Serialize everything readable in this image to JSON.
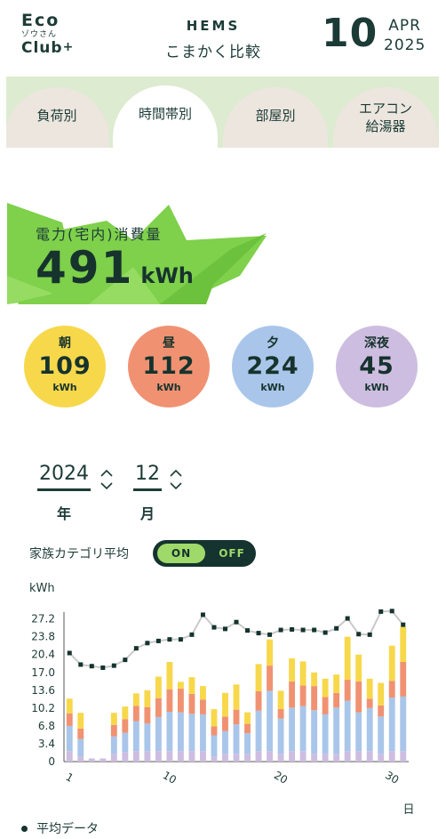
{
  "header": {
    "logo": {
      "line1": "Eco",
      "line2": "ゾウさん",
      "line3": "Club",
      "plus": "+"
    },
    "title1": "HEMS",
    "title2": "こまかく比較",
    "date_day": "10",
    "date_month": "APR",
    "date_year": "2025"
  },
  "tabs": [
    {
      "label": "負荷別",
      "active": false
    },
    {
      "label": "時間帯別",
      "active": true
    },
    {
      "label": "部屋別",
      "active": false
    },
    {
      "label": "エアコン\n給湯器",
      "active": false
    }
  ],
  "energy": {
    "label": "電力(宅内)消費量",
    "value": "491",
    "unit": "kWh"
  },
  "periods": [
    {
      "label": "朝",
      "value": "109",
      "unit": "kWh",
      "color": "#f7d84b"
    },
    {
      "label": "昼",
      "value": "112",
      "unit": "kWh",
      "color": "#f09272"
    },
    {
      "label": "夕",
      "value": "224",
      "unit": "kWh",
      "color": "#a9c6ea"
    },
    {
      "label": "深夜",
      "value": "45",
      "unit": "kWh",
      "color": "#cdbde0"
    }
  ],
  "picker": {
    "year": "2024",
    "year_label": "年",
    "month": "12",
    "month_label": "月"
  },
  "toggle": {
    "label": "家族カテゴリ平均",
    "on": "ON",
    "off": "OFF",
    "state": "on"
  },
  "legend": {
    "label": "平均データ"
  },
  "chart_data": {
    "type": "bar",
    "stacked": true,
    "ylabel": "kWh",
    "xlabel": "日",
    "ylim": [
      0,
      28.5
    ],
    "yticks": [
      0,
      3.4,
      6.8,
      10.2,
      13.6,
      17.0,
      20.4,
      23.8,
      27.2
    ],
    "xticks": [
      1,
      10,
      20,
      30
    ],
    "x": [
      1,
      2,
      3,
      4,
      5,
      6,
      7,
      8,
      9,
      10,
      11,
      12,
      13,
      14,
      15,
      16,
      17,
      18,
      19,
      20,
      21,
      22,
      23,
      24,
      25,
      26,
      27,
      28,
      29,
      30,
      31
    ],
    "series": [
      {
        "color": "#cdbde0",
        "values": [
          2.0,
          1.0,
          0.6,
          0.6,
          1.5,
          1.8,
          2.0,
          2.0,
          2.0,
          2.0,
          2.0,
          2.0,
          2.0,
          1.0,
          1.5,
          1.5,
          1.5,
          2.0,
          2.0,
          1.5,
          2.0,
          2.0,
          1.5,
          1.5,
          1.5,
          2.0,
          2.0,
          2.0,
          1.5,
          2.0,
          2.0
        ]
      },
      {
        "color": "#a9c6ea",
        "values": [
          4.8,
          3.3,
          0.0,
          0.0,
          3.3,
          3.7,
          5.7,
          5.3,
          6.5,
          7.5,
          7.4,
          7.1,
          7.0,
          4.0,
          4.3,
          5.6,
          3.9,
          7.7,
          11.5,
          6.7,
          8.3,
          8.6,
          8.3,
          7.5,
          8.8,
          9.6,
          7.4,
          8.2,
          7.1,
          10.2,
          10.4
        ]
      },
      {
        "color": "#f09272",
        "values": [
          2.4,
          2.0,
          0.0,
          0.0,
          2.2,
          2.6,
          2.9,
          3.1,
          3.6,
          4.3,
          4.5,
          3.8,
          2.8,
          1.7,
          2.8,
          2.8,
          1.8,
          3.7,
          4.8,
          1.8,
          5.0,
          3.9,
          4.6,
          3.3,
          2.8,
          4.0,
          5.9,
          1.8,
          2.1,
          3.2,
          6.6
        ]
      },
      {
        "color": "#f7d84b",
        "values": [
          2.8,
          3.0,
          0.0,
          0.0,
          2.3,
          2.4,
          2.4,
          3.2,
          4.1,
          5.2,
          1.3,
          3.2,
          2.6,
          3.3,
          4.5,
          4.8,
          2.2,
          5.2,
          5.0,
          3.5,
          4.4,
          4.6,
          2.6,
          3.5,
          3.5,
          8.2,
          5.1,
          3.8,
          4.3,
          6.7,
          6.7
        ]
      }
    ],
    "average": {
      "name": "平均データ",
      "color": "#15332f",
      "values": [
        20.7,
        18.5,
        18.2,
        17.9,
        18.3,
        19.4,
        21.6,
        22.6,
        23.0,
        23.3,
        23.3,
        24.2,
        28.0,
        25.6,
        25.3,
        26.6,
        25.0,
        24.5,
        24.2,
        25.1,
        25.2,
        25.1,
        25.1,
        24.6,
        25.4,
        27.3,
        24.3,
        24.2,
        28.6,
        28.7,
        26.1
      ]
    }
  }
}
